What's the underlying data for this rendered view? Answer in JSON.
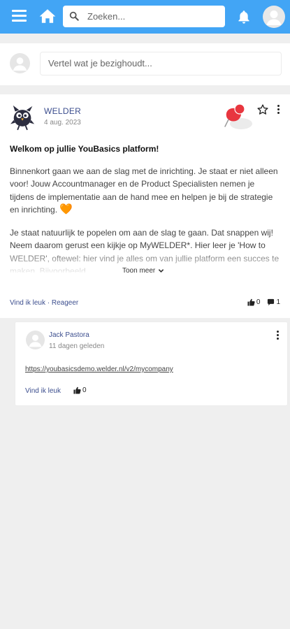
{
  "header": {
    "search_placeholder": "Zoeken..."
  },
  "composer": {
    "placeholder": "Vertel wat je bezighoudt..."
  },
  "post": {
    "author": "WELDER",
    "date": "4 aug. 2023",
    "title": "Welkom op jullie YouBasics platform!",
    "paragraph1": "Binnenkort gaan we aan de slag met de inrichting. Je staat er niet alleen voor! Jouw Accountmanager en de Product Specialisten nemen je tijdens de implementatie aan de hand mee en helpen je bij de strategie en inrichting.",
    "heart": "🧡",
    "paragraph2": "Je staat natuurlijk te popelen om aan de slag te gaan. Dat snappen wij! Neem daarom gerust een kijkje op MyWELDER*. Hier leer je 'How to WELDER', oftewel: hier vind je alles om van jullie platform een succes te maken. Bijvoorbeeld",
    "show_more": "Toon meer",
    "like_label": "Vind ik leuk",
    "separator": " · ",
    "reply_label": "Reageer",
    "like_count": "0",
    "comment_count": "1",
    "icons": [
      "pushpin-icon",
      "star-icon",
      "more-vertical-icon",
      "thumbs-up-icon",
      "comment-icon",
      "chevron-down-icon"
    ]
  },
  "comment": {
    "author": "Jack Pastora",
    "date": "11 dagen geleden",
    "link": "https://youbasicsdemo.welder.nl/v2/mycompany",
    "like_label": "Vind ik leuk",
    "like_count": "0"
  },
  "colors": {
    "topbar": "#42a5f5",
    "author_link": "#3c4e8e",
    "pin": "#e8363f"
  }
}
